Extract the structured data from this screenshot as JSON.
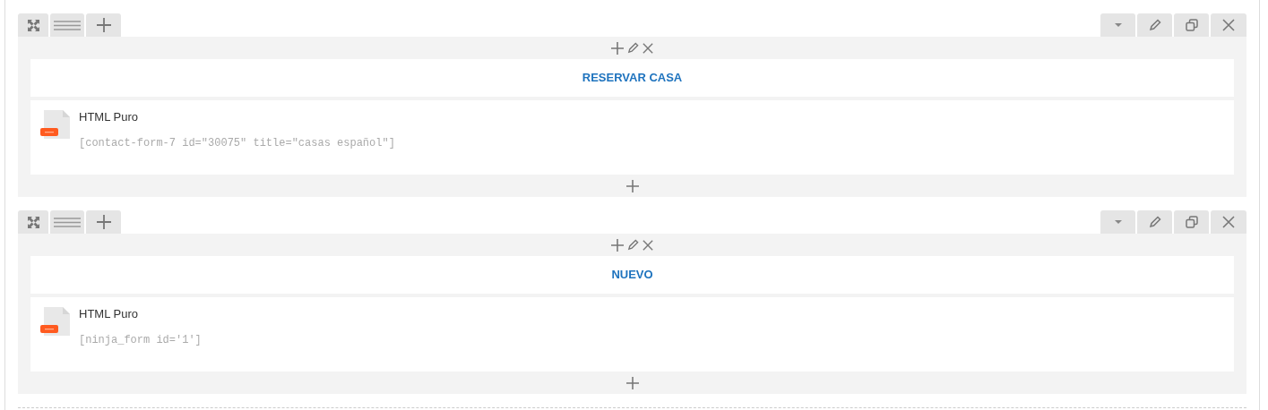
{
  "rows": [
    {
      "heading": "RESERVAR CASA",
      "widget": {
        "title": "HTML Puro",
        "code": "[contact-form-7 id=\"30075\" title=\"casas español\"]"
      }
    },
    {
      "heading": "NUEVO",
      "widget": {
        "title": "HTML Puro",
        "code": "[ninja_form id='1']"
      }
    }
  ]
}
